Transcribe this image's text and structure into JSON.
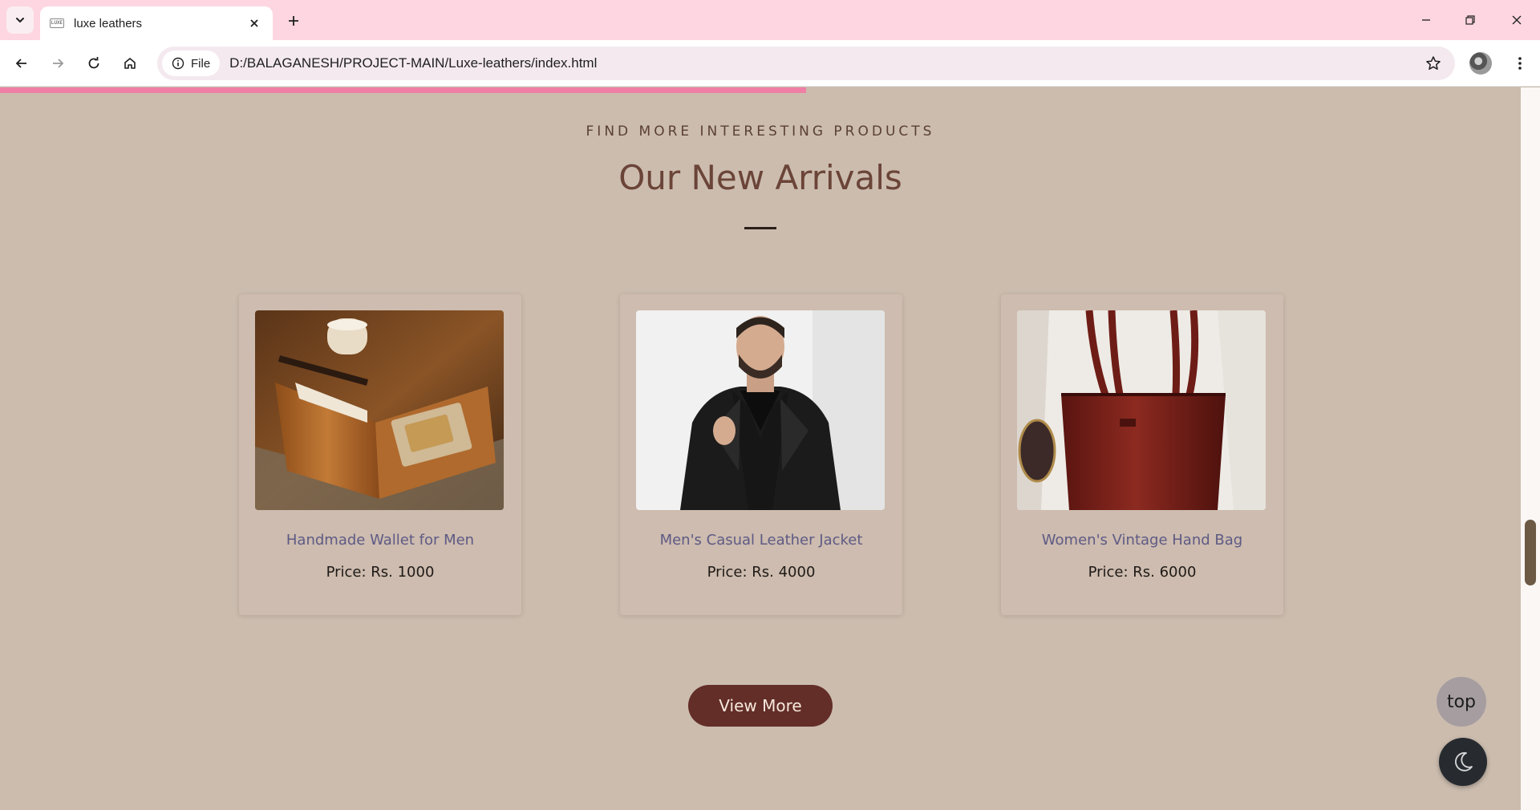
{
  "browser": {
    "tab": {
      "title": "luxe leathers",
      "favicon_text": "LUXE"
    },
    "address": {
      "chip_label": "File",
      "url": "D:/BALAGANESH/PROJECT-MAIN/Luxe-leathers/index.html"
    },
    "icons": [
      "tab-search-icon",
      "close-icon",
      "plus-icon",
      "minimize-icon",
      "restore-icon",
      "window-close-icon",
      "back-arrow-icon",
      "forward-arrow-icon",
      "reload-icon",
      "home-icon",
      "info-icon",
      "star-icon",
      "kebab-menu-icon"
    ],
    "colors": {
      "tabstrip": "#fdd6e1",
      "omnibox": "#f3e9ee",
      "scroll_progress": "#f07fa5"
    },
    "scroll_progress_fraction": 0.53
  },
  "section": {
    "subtitle": "FIND MORE INTERESTING PRODUCTS",
    "title": "Our New Arrivals"
  },
  "products": [
    {
      "name": "Handmade Wallet for Men",
      "price": "Price: Rs. 1000",
      "image": "wallet-photo"
    },
    {
      "name": "Men's Casual Leather Jacket",
      "price": "Price: Rs. 4000",
      "image": "jacket-photo"
    },
    {
      "name": "Women's Vintage Hand Bag",
      "price": "Price: Rs. 6000",
      "image": "handbag-photo"
    }
  ],
  "actions": {
    "view_more": "View More",
    "top": "top",
    "theme_icon": "moon-icon"
  },
  "colors": {
    "page_bg": "#cbbcae",
    "heading": "#6b4438",
    "product_name": "#5e5a85",
    "button": "#632e28",
    "top_button": "#a59da0",
    "theme_button": "#272b30"
  }
}
